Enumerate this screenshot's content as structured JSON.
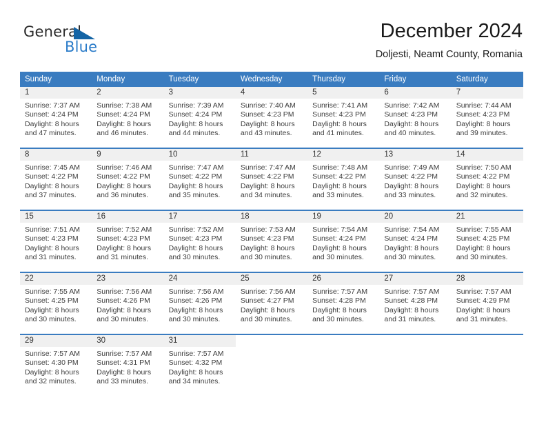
{
  "brand": {
    "word_one": "General",
    "word_two": "Blue",
    "logo_icon": "triangle-logo-icon",
    "accent_color": "#1464a5",
    "secondary_color": "#2b7cc9"
  },
  "header": {
    "title": "December 2024",
    "subtitle": "Doljesti, Neamt County, Romania"
  },
  "theme": {
    "header_row_color": "#3a7cc0",
    "day_band_color": "#f0f0f0",
    "text_color": "#3c3c3c"
  },
  "weekday_headers": [
    "Sunday",
    "Monday",
    "Tuesday",
    "Wednesday",
    "Thursday",
    "Friday",
    "Saturday"
  ],
  "labels": {
    "sunrise_prefix": "Sunrise:",
    "sunset_prefix": "Sunset:",
    "daylight_prefix": "Daylight:"
  },
  "weeks": [
    {
      "days": [
        {
          "num": "1",
          "sunrise": "Sunrise: 7:37 AM",
          "sunset": "Sunset: 4:24 PM",
          "daylight_line1": "Daylight: 8 hours",
          "daylight_line2": "and 47 minutes."
        },
        {
          "num": "2",
          "sunrise": "Sunrise: 7:38 AM",
          "sunset": "Sunset: 4:24 PM",
          "daylight_line1": "Daylight: 8 hours",
          "daylight_line2": "and 46 minutes."
        },
        {
          "num": "3",
          "sunrise": "Sunrise: 7:39 AM",
          "sunset": "Sunset: 4:24 PM",
          "daylight_line1": "Daylight: 8 hours",
          "daylight_line2": "and 44 minutes."
        },
        {
          "num": "4",
          "sunrise": "Sunrise: 7:40 AM",
          "sunset": "Sunset: 4:23 PM",
          "daylight_line1": "Daylight: 8 hours",
          "daylight_line2": "and 43 minutes."
        },
        {
          "num": "5",
          "sunrise": "Sunrise: 7:41 AM",
          "sunset": "Sunset: 4:23 PM",
          "daylight_line1": "Daylight: 8 hours",
          "daylight_line2": "and 41 minutes."
        },
        {
          "num": "6",
          "sunrise": "Sunrise: 7:42 AM",
          "sunset": "Sunset: 4:23 PM",
          "daylight_line1": "Daylight: 8 hours",
          "daylight_line2": "and 40 minutes."
        },
        {
          "num": "7",
          "sunrise": "Sunrise: 7:44 AM",
          "sunset": "Sunset: 4:23 PM",
          "daylight_line1": "Daylight: 8 hours",
          "daylight_line2": "and 39 minutes."
        }
      ]
    },
    {
      "days": [
        {
          "num": "8",
          "sunrise": "Sunrise: 7:45 AM",
          "sunset": "Sunset: 4:22 PM",
          "daylight_line1": "Daylight: 8 hours",
          "daylight_line2": "and 37 minutes."
        },
        {
          "num": "9",
          "sunrise": "Sunrise: 7:46 AM",
          "sunset": "Sunset: 4:22 PM",
          "daylight_line1": "Daylight: 8 hours",
          "daylight_line2": "and 36 minutes."
        },
        {
          "num": "10",
          "sunrise": "Sunrise: 7:47 AM",
          "sunset": "Sunset: 4:22 PM",
          "daylight_line1": "Daylight: 8 hours",
          "daylight_line2": "and 35 minutes."
        },
        {
          "num": "11",
          "sunrise": "Sunrise: 7:47 AM",
          "sunset": "Sunset: 4:22 PM",
          "daylight_line1": "Daylight: 8 hours",
          "daylight_line2": "and 34 minutes."
        },
        {
          "num": "12",
          "sunrise": "Sunrise: 7:48 AM",
          "sunset": "Sunset: 4:22 PM",
          "daylight_line1": "Daylight: 8 hours",
          "daylight_line2": "and 33 minutes."
        },
        {
          "num": "13",
          "sunrise": "Sunrise: 7:49 AM",
          "sunset": "Sunset: 4:22 PM",
          "daylight_line1": "Daylight: 8 hours",
          "daylight_line2": "and 33 minutes."
        },
        {
          "num": "14",
          "sunrise": "Sunrise: 7:50 AM",
          "sunset": "Sunset: 4:22 PM",
          "daylight_line1": "Daylight: 8 hours",
          "daylight_line2": "and 32 minutes."
        }
      ]
    },
    {
      "days": [
        {
          "num": "15",
          "sunrise": "Sunrise: 7:51 AM",
          "sunset": "Sunset: 4:23 PM",
          "daylight_line1": "Daylight: 8 hours",
          "daylight_line2": "and 31 minutes."
        },
        {
          "num": "16",
          "sunrise": "Sunrise: 7:52 AM",
          "sunset": "Sunset: 4:23 PM",
          "daylight_line1": "Daylight: 8 hours",
          "daylight_line2": "and 31 minutes."
        },
        {
          "num": "17",
          "sunrise": "Sunrise: 7:52 AM",
          "sunset": "Sunset: 4:23 PM",
          "daylight_line1": "Daylight: 8 hours",
          "daylight_line2": "and 30 minutes."
        },
        {
          "num": "18",
          "sunrise": "Sunrise: 7:53 AM",
          "sunset": "Sunset: 4:23 PM",
          "daylight_line1": "Daylight: 8 hours",
          "daylight_line2": "and 30 minutes."
        },
        {
          "num": "19",
          "sunrise": "Sunrise: 7:54 AM",
          "sunset": "Sunset: 4:24 PM",
          "daylight_line1": "Daylight: 8 hours",
          "daylight_line2": "and 30 minutes."
        },
        {
          "num": "20",
          "sunrise": "Sunrise: 7:54 AM",
          "sunset": "Sunset: 4:24 PM",
          "daylight_line1": "Daylight: 8 hours",
          "daylight_line2": "and 30 minutes."
        },
        {
          "num": "21",
          "sunrise": "Sunrise: 7:55 AM",
          "sunset": "Sunset: 4:25 PM",
          "daylight_line1": "Daylight: 8 hours",
          "daylight_line2": "and 30 minutes."
        }
      ]
    },
    {
      "days": [
        {
          "num": "22",
          "sunrise": "Sunrise: 7:55 AM",
          "sunset": "Sunset: 4:25 PM",
          "daylight_line1": "Daylight: 8 hours",
          "daylight_line2": "and 30 minutes."
        },
        {
          "num": "23",
          "sunrise": "Sunrise: 7:56 AM",
          "sunset": "Sunset: 4:26 PM",
          "daylight_line1": "Daylight: 8 hours",
          "daylight_line2": "and 30 minutes."
        },
        {
          "num": "24",
          "sunrise": "Sunrise: 7:56 AM",
          "sunset": "Sunset: 4:26 PM",
          "daylight_line1": "Daylight: 8 hours",
          "daylight_line2": "and 30 minutes."
        },
        {
          "num": "25",
          "sunrise": "Sunrise: 7:56 AM",
          "sunset": "Sunset: 4:27 PM",
          "daylight_line1": "Daylight: 8 hours",
          "daylight_line2": "and 30 minutes."
        },
        {
          "num": "26",
          "sunrise": "Sunrise: 7:57 AM",
          "sunset": "Sunset: 4:28 PM",
          "daylight_line1": "Daylight: 8 hours",
          "daylight_line2": "and 30 minutes."
        },
        {
          "num": "27",
          "sunrise": "Sunrise: 7:57 AM",
          "sunset": "Sunset: 4:28 PM",
          "daylight_line1": "Daylight: 8 hours",
          "daylight_line2": "and 31 minutes."
        },
        {
          "num": "28",
          "sunrise": "Sunrise: 7:57 AM",
          "sunset": "Sunset: 4:29 PM",
          "daylight_line1": "Daylight: 8 hours",
          "daylight_line2": "and 31 minutes."
        }
      ]
    },
    {
      "days": [
        {
          "num": "29",
          "sunrise": "Sunrise: 7:57 AM",
          "sunset": "Sunset: 4:30 PM",
          "daylight_line1": "Daylight: 8 hours",
          "daylight_line2": "and 32 minutes."
        },
        {
          "num": "30",
          "sunrise": "Sunrise: 7:57 AM",
          "sunset": "Sunset: 4:31 PM",
          "daylight_line1": "Daylight: 8 hours",
          "daylight_line2": "and 33 minutes."
        },
        {
          "num": "31",
          "sunrise": "Sunrise: 7:57 AM",
          "sunset": "Sunset: 4:32 PM",
          "daylight_line1": "Daylight: 8 hours",
          "daylight_line2": "and 34 minutes."
        },
        {
          "num": "",
          "sunrise": "",
          "sunset": "",
          "daylight_line1": "",
          "daylight_line2": ""
        },
        {
          "num": "",
          "sunrise": "",
          "sunset": "",
          "daylight_line1": "",
          "daylight_line2": ""
        },
        {
          "num": "",
          "sunrise": "",
          "sunset": "",
          "daylight_line1": "",
          "daylight_line2": ""
        },
        {
          "num": "",
          "sunrise": "",
          "sunset": "",
          "daylight_line1": "",
          "daylight_line2": ""
        }
      ]
    }
  ]
}
